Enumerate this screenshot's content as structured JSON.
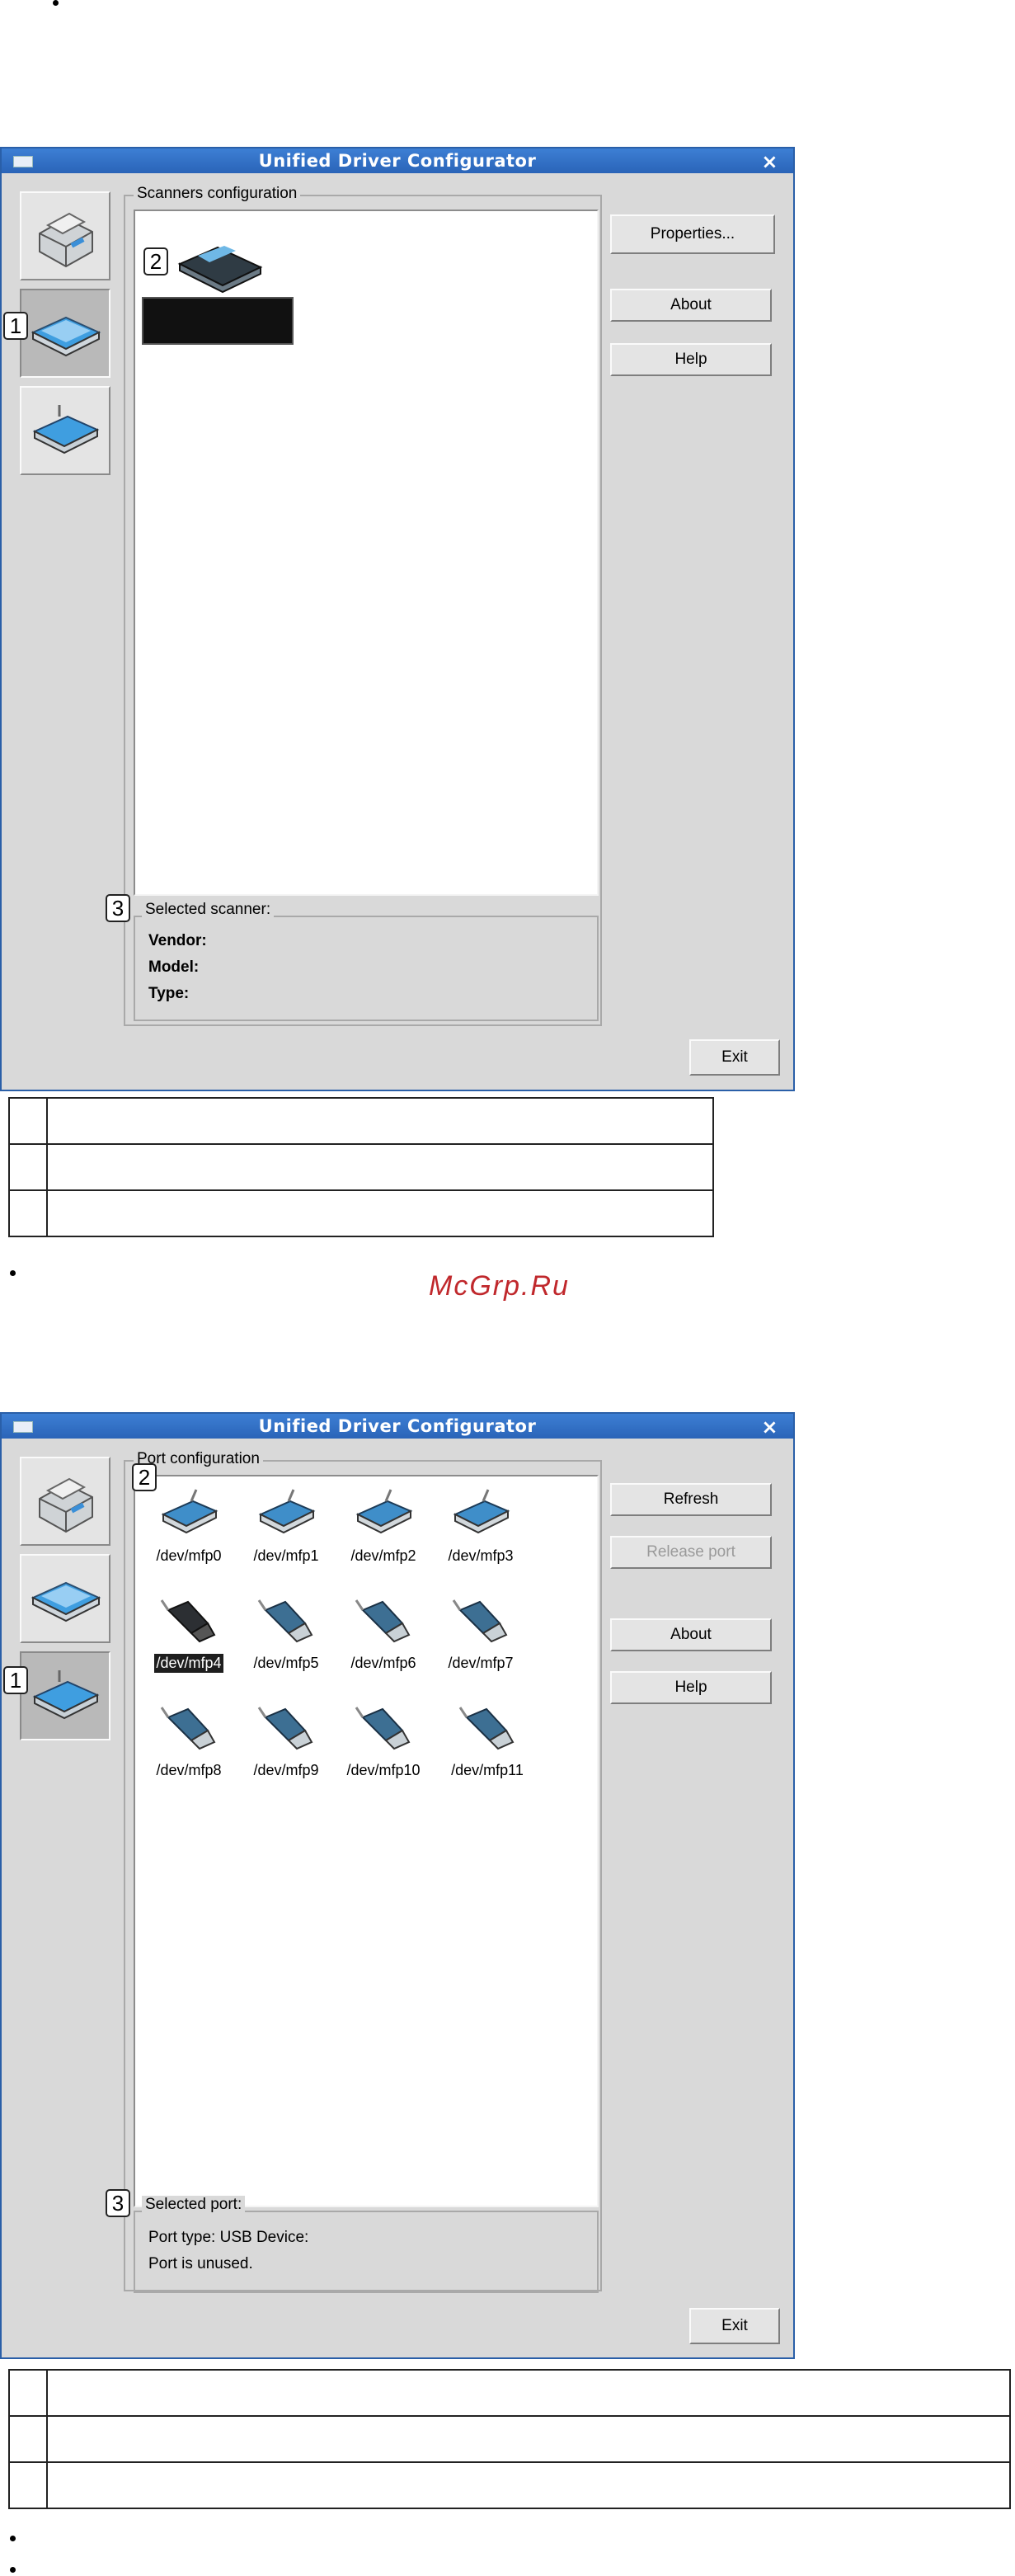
{
  "screen1": {
    "title": "Unified Driver Configurator",
    "group_label": "Scanners configuration",
    "buttons": {
      "properties": "Properties...",
      "about": "About",
      "help": "Help",
      "exit": "Exit"
    },
    "info_label": "Selected scanner:",
    "info_lines": {
      "vendor": "Vendor:",
      "model": "Model:",
      "type": "Type:"
    },
    "callouts": [
      "1",
      "2",
      "3"
    ]
  },
  "watermark": "McGrp.Ru",
  "screen2": {
    "title": "Unified Driver Configurator",
    "group_label": "Port configuration",
    "buttons": {
      "refresh": "Refresh",
      "release_port": "Release port",
      "about": "About",
      "help": "Help",
      "exit": "Exit"
    },
    "ports": [
      "/dev/mfp0",
      "/dev/mfp1",
      "/dev/mfp2",
      "/dev/mfp3",
      "/dev/mfp4",
      "/dev/mfp5",
      "/dev/mfp6",
      "/dev/mfp7",
      "/dev/mfp8",
      "/dev/mfp9",
      "/dev/mfp10",
      "/dev/mfp11"
    ],
    "selected_port": "/dev/mfp4",
    "info_label": "Selected port:",
    "info_lines": {
      "port_type": "Port type: USB   Device:",
      "status": "Port is unused."
    },
    "callouts": [
      "1",
      "2",
      "3"
    ]
  }
}
